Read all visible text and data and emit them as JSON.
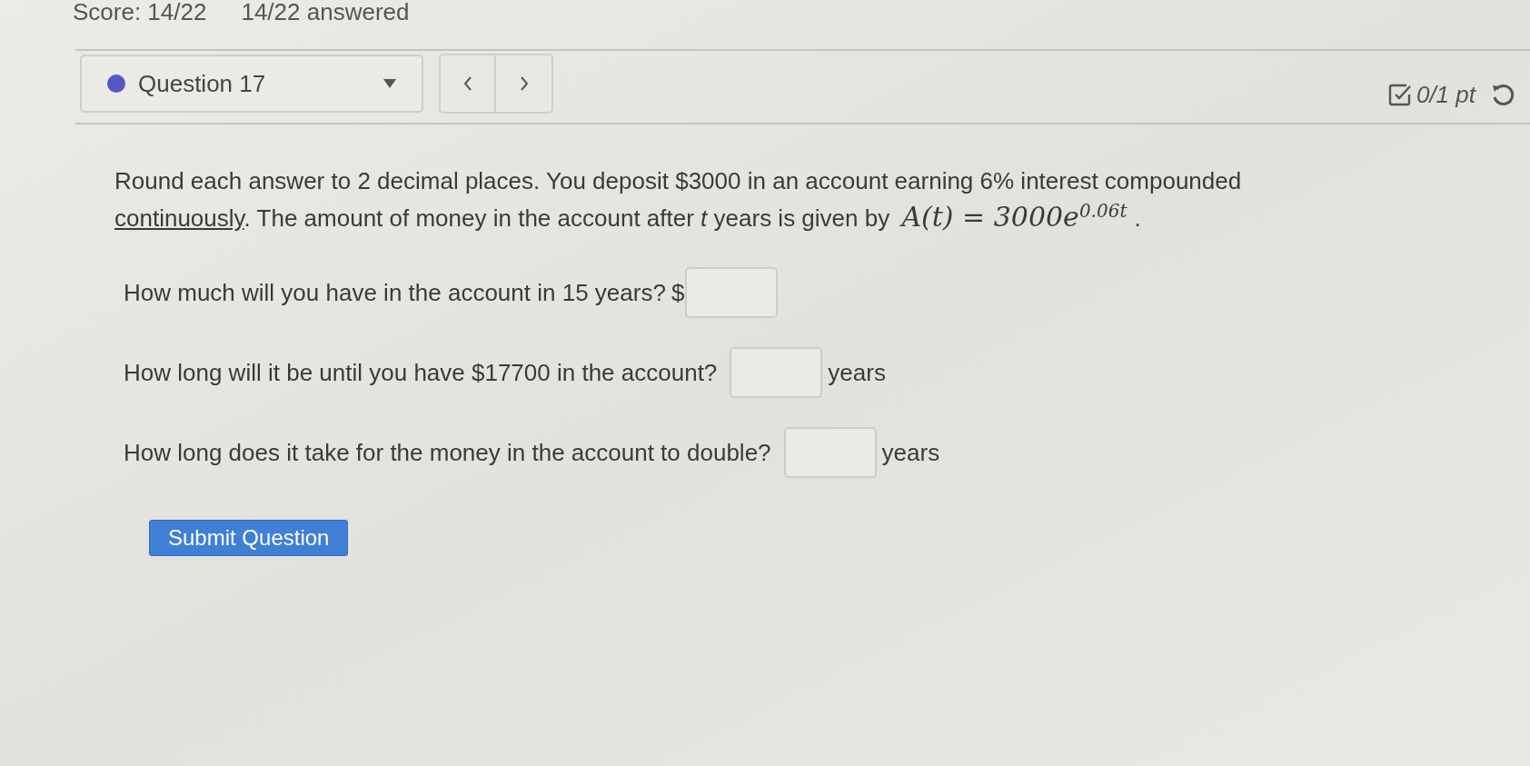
{
  "header": {
    "score": "Score: 14/22",
    "answered": "14/22 answered"
  },
  "question_selector": {
    "label": "Question 17"
  },
  "points": {
    "text": "0/1 pt"
  },
  "question": {
    "prompt_before": "Round each answer to 2 decimal places. You deposit $3000 in an account earning 6% interest compounded",
    "link": "continuously",
    "prompt_after": ". The amount of money in the account after *t* years is given by",
    "formula": {
      "base": "A(t) = 3000e",
      "exponent": "0.06t"
    },
    "end": "."
  },
  "parts": [
    {
      "prompt": "How much will you have in the account in 15 years?",
      "unit_before": "$"
    },
    {
      "prompt": "How long will it be until you have $17700 in the account?",
      "unit_after": "years"
    },
    {
      "prompt": "How long does it take for the money in the account to double?",
      "unit_after": "years"
    }
  ],
  "submit_button": "Submit Question"
}
